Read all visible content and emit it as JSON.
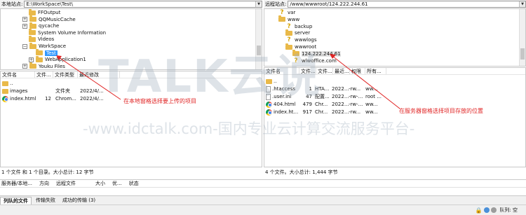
{
  "local": {
    "site_label": "本地站点:",
    "site_path": "E:\\WorkSpace\\Test\\",
    "tree": [
      {
        "name": "FFOutput",
        "expander": ""
      },
      {
        "name": "QQMusicCache",
        "expander": "+"
      },
      {
        "name": "qycache",
        "expander": "+"
      },
      {
        "name": "System Volume Information",
        "expander": ""
      },
      {
        "name": "Videos",
        "expander": ""
      },
      {
        "name": "WorkSpace",
        "expander": "−"
      },
      {
        "name": "Test",
        "expander": ""
      },
      {
        "name": "WebApplication1",
        "expander": "+"
      },
      {
        "name": "Youku Files",
        "expander": "+"
      }
    ],
    "columns": [
      "文件名",
      "文件...",
      "文件类型",
      "最近修改"
    ],
    "files": [
      {
        "icon": "folder",
        "name": "..",
        "size": "",
        "type": "",
        "modified": ""
      },
      {
        "icon": "folder",
        "name": "images",
        "size": "",
        "type": "文件夹",
        "modified": "2022/4/..."
      },
      {
        "icon": "chrome",
        "name": "index.html",
        "size": "12",
        "type": "Chrom...",
        "modified": "2022/4/..."
      }
    ],
    "status": "1 个文件 和 1 个目录。大小总计: 12 字节"
  },
  "remote": {
    "site_label": "远程站点:",
    "site_path": "/www/wwwroot/124.222.244.61",
    "tree": [
      {
        "name": "var",
        "icon": "question"
      },
      {
        "name": "www",
        "icon": "folder"
      },
      {
        "name": "backup",
        "icon": "question"
      },
      {
        "name": "server",
        "icon": "folder"
      },
      {
        "name": "wwwlogs",
        "icon": "question"
      },
      {
        "name": "wwwroot",
        "icon": "folder"
      },
      {
        "name": "124.222.244.61",
        "icon": "folder"
      },
      {
        "name": "wlwoffice.com",
        "icon": "question"
      }
    ],
    "columns": [
      "文件名",
      "文件...",
      "文件...",
      "最近...",
      "权限",
      "所有..."
    ],
    "files": [
      {
        "icon": "folder",
        "name": "..",
        "size": "",
        "type": "",
        "modified": "",
        "perm": "",
        "owner": ""
      },
      {
        "icon": "doc",
        "name": ".htaccess",
        "size": "1",
        "type": "HTA...",
        "modified": "2022...",
        "perm": "-rw...",
        "owner": "ww..."
      },
      {
        "icon": "doc",
        "name": ".user.ini",
        "size": "47",
        "type": "配置...",
        "modified": "2022...",
        "perm": "-rw-...",
        "owner": "root ..."
      },
      {
        "icon": "chrome",
        "name": "404.html",
        "size": "479",
        "type": "Chr...",
        "modified": "2022...",
        "perm": "-rw-...",
        "owner": "ww..."
      },
      {
        "icon": "chrome",
        "name": "index.ht...",
        "size": "917",
        "type": "Chr...",
        "modified": "2022...",
        "perm": "-rw...",
        "owner": "ww..."
      }
    ],
    "status": "4 个文件。大小总计: 1,444 字节"
  },
  "queue": {
    "columns": [
      "服务器/本地...",
      "方向",
      "远程文件",
      "大小",
      "优...",
      "状态"
    ],
    "tabs": [
      "列队的文件",
      "传输失败",
      "成功的传输 (3)"
    ],
    "status_label": "队列: 空"
  },
  "annotations": {
    "local": "在本地窗格选择要上传的项目",
    "remote": "在服务器窗格选择项目存放的位置"
  },
  "watermark": {
    "brand": "TALK云说",
    "text": "-www.idctalk.com-国内专业云计算交流服务平台-"
  },
  "colors": {
    "selection": "#3399ff",
    "annotation": "#e02424",
    "folder": "#e9b949"
  }
}
